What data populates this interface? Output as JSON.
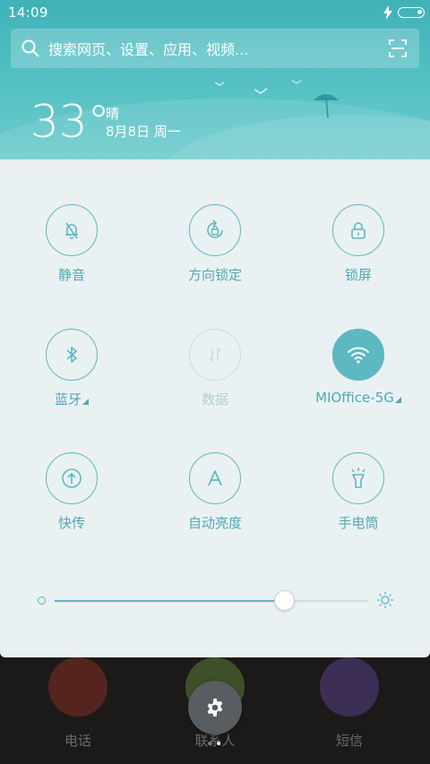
{
  "status_bar": {
    "time": "14:09"
  },
  "search": {
    "placeholder": "搜索网页、设置、应用、视频..."
  },
  "weather": {
    "temperature": "33°",
    "condition": "晴",
    "date": "8月8日 周一"
  },
  "toggles": [
    {
      "label": "静音",
      "icon": "bell-muted-icon",
      "state": "off"
    },
    {
      "label": "方向锁定",
      "icon": "rotation-lock-icon",
      "state": "off"
    },
    {
      "label": "锁屏",
      "icon": "lock-icon",
      "state": "off"
    },
    {
      "label": "蓝牙",
      "icon": "bluetooth-icon",
      "state": "off"
    },
    {
      "label": "数据",
      "icon": "mobile-data-icon",
      "state": "disabled"
    },
    {
      "label": "MIOffice-5G",
      "icon": "wifi-icon",
      "state": "on"
    },
    {
      "label": "快传",
      "icon": "transfer-icon",
      "state": "off"
    },
    {
      "label": "自动亮度",
      "icon": "auto-brightness-icon",
      "state": "off"
    },
    {
      "label": "手电筒",
      "icon": "flashlight-icon",
      "state": "off"
    }
  ],
  "brightness": {
    "level": 0.73
  },
  "dock": [
    {
      "label": "电话",
      "icon": "phone-icon"
    },
    {
      "label": "联系人",
      "icon": "contacts-icon"
    },
    {
      "label": "短信",
      "icon": "message-icon"
    }
  ],
  "colors": {
    "accent": "#5db8c1",
    "panel_bg": "#eaf1f3",
    "header": "#4fb9be"
  }
}
